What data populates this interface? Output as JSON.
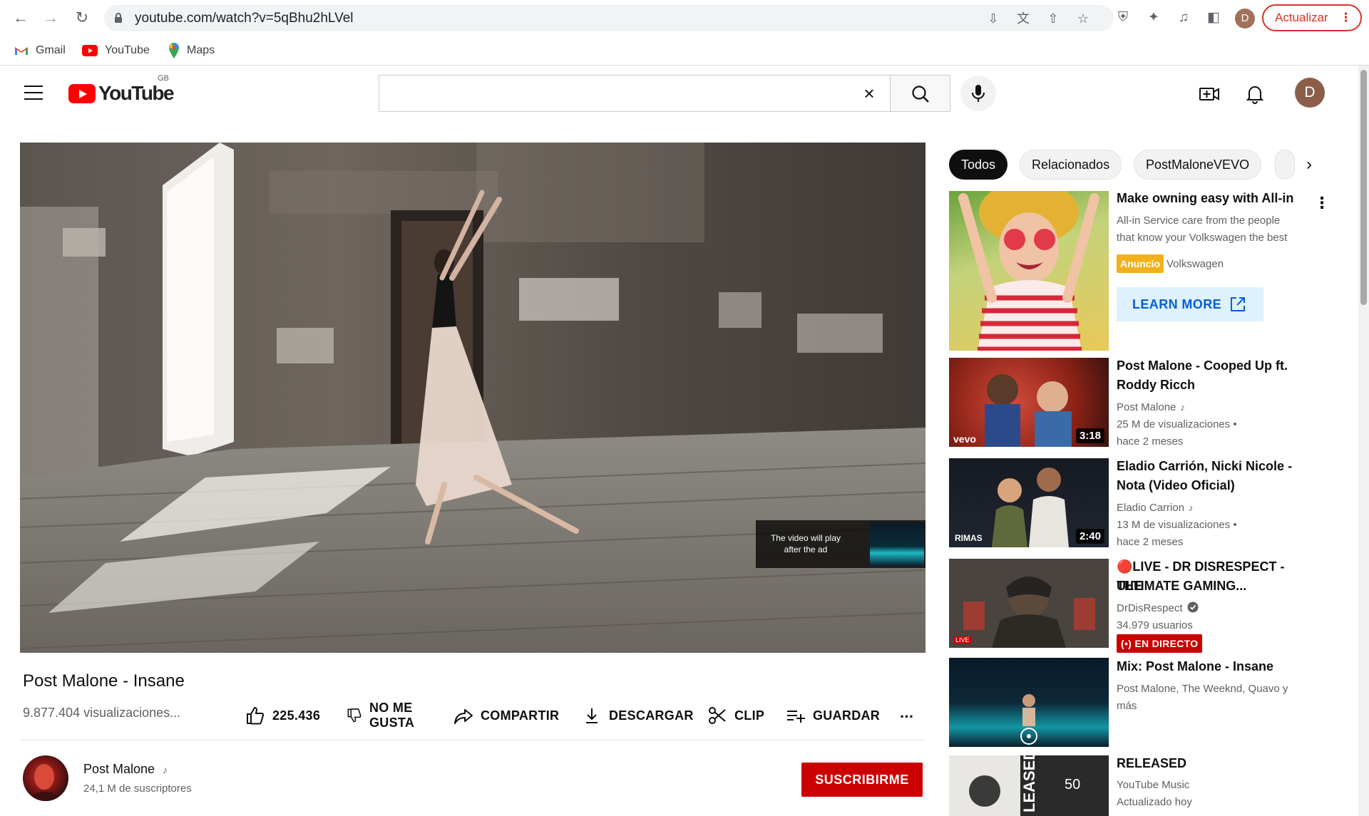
{
  "browser": {
    "url": "youtube.com/watch?v=5qBhu2hLVel",
    "profile_initial": "D",
    "update_label": "Actualizar",
    "bookmarks": [
      {
        "label": "Gmail",
        "icon": "gmail-icon"
      },
      {
        "label": "YouTube",
        "icon": "youtube-icon"
      },
      {
        "label": "Maps",
        "icon": "maps-icon"
      }
    ],
    "colors": {
      "update_accent": "#d93025"
    }
  },
  "yt_header": {
    "logo_text": "YouTube",
    "country_code": "GB",
    "search_value": "",
    "avatar_initial": "D",
    "colors": {
      "brand_red": "#ff0000"
    }
  },
  "player": {
    "ad_overlay_text": "The video will play after the ad"
  },
  "video": {
    "title": "Post Malone - Insane",
    "views": "9.877.404 visualizaciones...",
    "actions": {
      "likes": "225.436",
      "dislike_label_1": "NO ME",
      "dislike_label_2": "GUSTA",
      "share": "COMPARTIR",
      "download": "DESCARGAR",
      "clip": "CLIP",
      "save": "GUARDAR",
      "more": "..."
    },
    "channel": {
      "name": "Post Malone",
      "subscribers": "24,1 M de suscriptores",
      "subscribe_label": "SUSCRIBIRME"
    },
    "colors": {
      "subscribe": "#cc0000"
    }
  },
  "sidebar": {
    "chips": [
      "Todos",
      "Relacionados",
      "PostMaloneVEVO"
    ],
    "ad": {
      "title": "Make owning easy with All-in",
      "description_1": "All-in Service care from the people",
      "description_2": "that know your Volkswagen the best",
      "badge": "Anuncio",
      "advertiser": "Volkswagen",
      "cta": "LEARN MORE",
      "colors": {
        "badge": "#f2b11c",
        "cta_text": "#065fd4",
        "cta_bg": "#def1ff"
      }
    },
    "videos": [
      {
        "title_1": "Post Malone - Cooped Up ft.",
        "title_2": "Roddy Ricch",
        "channel": "Post Malone",
        "views": "25 M de visualizaciones •",
        "age": "hace 2 meses",
        "duration": "3:18",
        "thumb_tag": "vevo"
      },
      {
        "title_1": "Eladio Carrión, Nicki Nicole -",
        "title_2": "Nota (Video Oficial)",
        "channel": "Eladio Carrion",
        "views": "13 M de visualizaciones •",
        "age": "hace 2 meses",
        "duration": "2:40",
        "thumb_tag": "RIMAS"
      },
      {
        "title_1": "🔴LIVE - DR DISRESPECT - THE",
        "title_2": "ULTIMATE GAMING...",
        "channel": "DrDisRespect",
        "views": "34.979 usuarios",
        "live_badge": "EN DIRECTO",
        "thumb_tag": "LIVE"
      },
      {
        "title_1": "Mix: Post Malone - Insane",
        "meta_1": "Post Malone, The Weeknd, Quavo y",
        "meta_2": "más"
      },
      {
        "title_1": "RELEASED",
        "meta_1": "YouTube Music",
        "meta_2": "Actualizado hoy",
        "playlist_count": "50",
        "thumb_tag": "LEASED"
      }
    ]
  }
}
